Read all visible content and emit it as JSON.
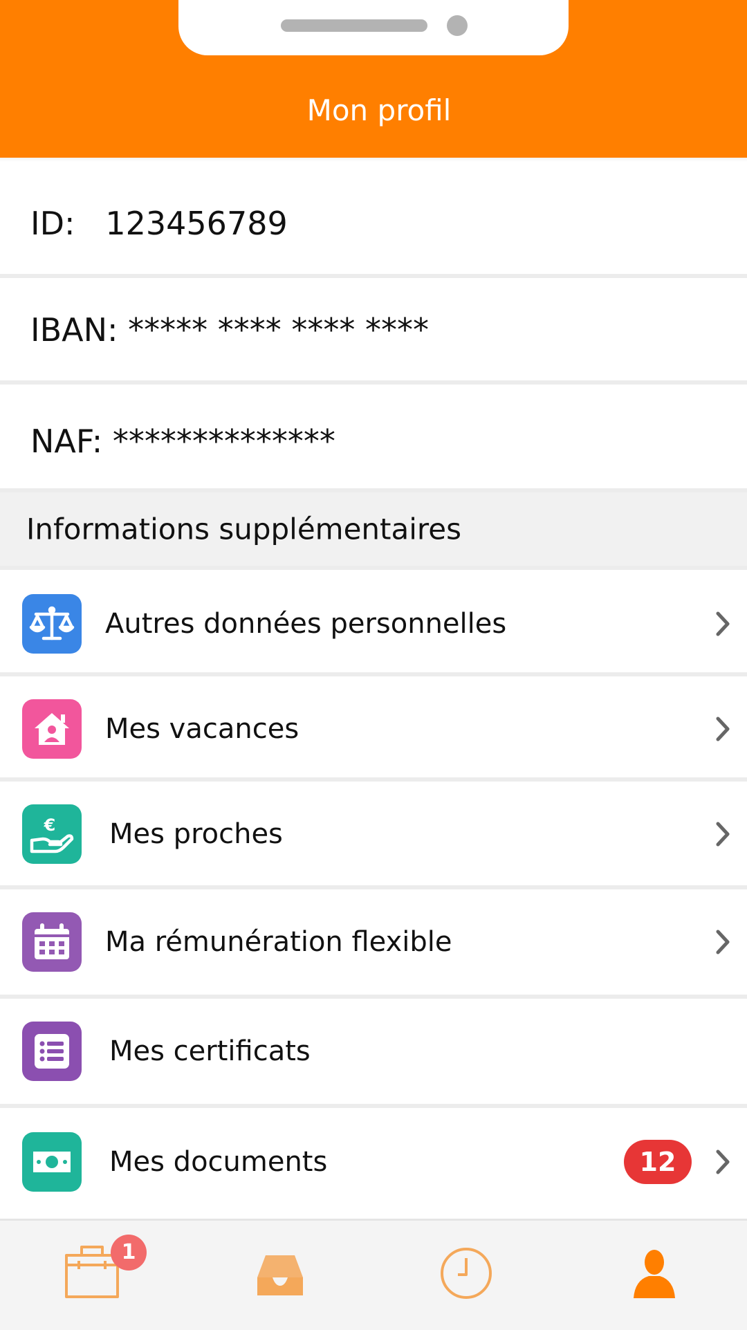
{
  "header": {
    "title": "Mon profil",
    "color": "#ff7f00"
  },
  "profile": {
    "id": "ID:   123456789",
    "iban": "IBAN: ***** **** **** ****",
    "naf": "NAF: **************"
  },
  "section": {
    "title": "Informations supplémentaires"
  },
  "menu": [
    {
      "label": "Autres données personnelles",
      "icon": "scales-icon",
      "color": "#3a86e6",
      "has_chevron": true
    },
    {
      "label": "Mes vacances",
      "icon": "house-person-icon",
      "color": "#f2569c",
      "has_chevron": true
    },
    {
      "label": "Mes proches",
      "icon": "euro-hand-icon",
      "color": "#1fb59a",
      "has_chevron": true
    },
    {
      "label": "Ma rémunération flexible",
      "icon": "calendar-icon",
      "color": "#9359b3",
      "has_chevron": true
    },
    {
      "label": "Mes certificats",
      "icon": "list-icon",
      "color": "#8b4fb0",
      "has_chevron": false
    },
    {
      "label": "Mes documents",
      "icon": "banknote-icon",
      "color": "#1fb59a",
      "has_chevron": true,
      "badge": "12"
    }
  ],
  "tabbar": {
    "tabs": [
      {
        "name": "briefcase-icon",
        "badge": "1"
      },
      {
        "name": "inbox-icon"
      },
      {
        "name": "clock-icon"
      },
      {
        "name": "person-icon",
        "active": true
      }
    ],
    "accent": "#ff7f00",
    "inactive": "#f4a85a"
  }
}
